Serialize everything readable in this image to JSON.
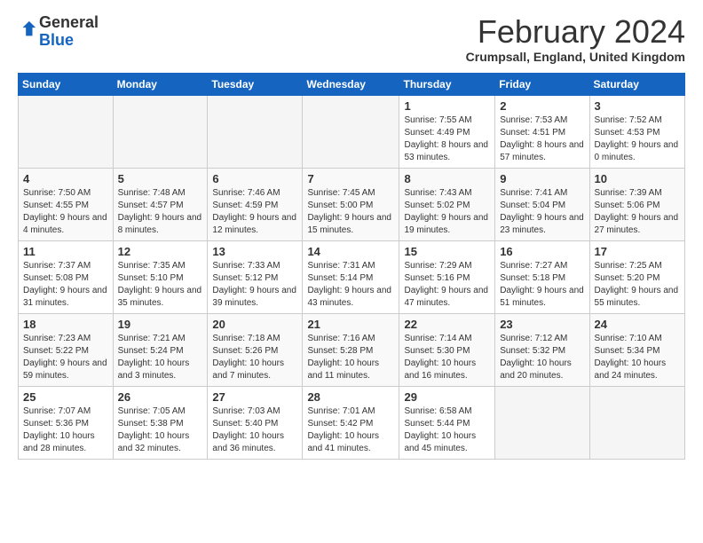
{
  "header": {
    "logo_general": "General",
    "logo_blue": "Blue",
    "month_title": "February 2024",
    "location": "Crumpsall, England, United Kingdom"
  },
  "weekdays": [
    "Sunday",
    "Monday",
    "Tuesday",
    "Wednesday",
    "Thursday",
    "Friday",
    "Saturday"
  ],
  "weeks": [
    [
      {
        "day": "",
        "empty": true
      },
      {
        "day": "",
        "empty": true
      },
      {
        "day": "",
        "empty": true
      },
      {
        "day": "",
        "empty": true
      },
      {
        "day": "1",
        "sunrise": "Sunrise: 7:55 AM",
        "sunset": "Sunset: 4:49 PM",
        "daylight": "Daylight: 8 hours and 53 minutes."
      },
      {
        "day": "2",
        "sunrise": "Sunrise: 7:53 AM",
        "sunset": "Sunset: 4:51 PM",
        "daylight": "Daylight: 8 hours and 57 minutes."
      },
      {
        "day": "3",
        "sunrise": "Sunrise: 7:52 AM",
        "sunset": "Sunset: 4:53 PM",
        "daylight": "Daylight: 9 hours and 0 minutes."
      }
    ],
    [
      {
        "day": "4",
        "sunrise": "Sunrise: 7:50 AM",
        "sunset": "Sunset: 4:55 PM",
        "daylight": "Daylight: 9 hours and 4 minutes."
      },
      {
        "day": "5",
        "sunrise": "Sunrise: 7:48 AM",
        "sunset": "Sunset: 4:57 PM",
        "daylight": "Daylight: 9 hours and 8 minutes."
      },
      {
        "day": "6",
        "sunrise": "Sunrise: 7:46 AM",
        "sunset": "Sunset: 4:59 PM",
        "daylight": "Daylight: 9 hours and 12 minutes."
      },
      {
        "day": "7",
        "sunrise": "Sunrise: 7:45 AM",
        "sunset": "Sunset: 5:00 PM",
        "daylight": "Daylight: 9 hours and 15 minutes."
      },
      {
        "day": "8",
        "sunrise": "Sunrise: 7:43 AM",
        "sunset": "Sunset: 5:02 PM",
        "daylight": "Daylight: 9 hours and 19 minutes."
      },
      {
        "day": "9",
        "sunrise": "Sunrise: 7:41 AM",
        "sunset": "Sunset: 5:04 PM",
        "daylight": "Daylight: 9 hours and 23 minutes."
      },
      {
        "day": "10",
        "sunrise": "Sunrise: 7:39 AM",
        "sunset": "Sunset: 5:06 PM",
        "daylight": "Daylight: 9 hours and 27 minutes."
      }
    ],
    [
      {
        "day": "11",
        "sunrise": "Sunrise: 7:37 AM",
        "sunset": "Sunset: 5:08 PM",
        "daylight": "Daylight: 9 hours and 31 minutes."
      },
      {
        "day": "12",
        "sunrise": "Sunrise: 7:35 AM",
        "sunset": "Sunset: 5:10 PM",
        "daylight": "Daylight: 9 hours and 35 minutes."
      },
      {
        "day": "13",
        "sunrise": "Sunrise: 7:33 AM",
        "sunset": "Sunset: 5:12 PM",
        "daylight": "Daylight: 9 hours and 39 minutes."
      },
      {
        "day": "14",
        "sunrise": "Sunrise: 7:31 AM",
        "sunset": "Sunset: 5:14 PM",
        "daylight": "Daylight: 9 hours and 43 minutes."
      },
      {
        "day": "15",
        "sunrise": "Sunrise: 7:29 AM",
        "sunset": "Sunset: 5:16 PM",
        "daylight": "Daylight: 9 hours and 47 minutes."
      },
      {
        "day": "16",
        "sunrise": "Sunrise: 7:27 AM",
        "sunset": "Sunset: 5:18 PM",
        "daylight": "Daylight: 9 hours and 51 minutes."
      },
      {
        "day": "17",
        "sunrise": "Sunrise: 7:25 AM",
        "sunset": "Sunset: 5:20 PM",
        "daylight": "Daylight: 9 hours and 55 minutes."
      }
    ],
    [
      {
        "day": "18",
        "sunrise": "Sunrise: 7:23 AM",
        "sunset": "Sunset: 5:22 PM",
        "daylight": "Daylight: 9 hours and 59 minutes."
      },
      {
        "day": "19",
        "sunrise": "Sunrise: 7:21 AM",
        "sunset": "Sunset: 5:24 PM",
        "daylight": "Daylight: 10 hours and 3 minutes."
      },
      {
        "day": "20",
        "sunrise": "Sunrise: 7:18 AM",
        "sunset": "Sunset: 5:26 PM",
        "daylight": "Daylight: 10 hours and 7 minutes."
      },
      {
        "day": "21",
        "sunrise": "Sunrise: 7:16 AM",
        "sunset": "Sunset: 5:28 PM",
        "daylight": "Daylight: 10 hours and 11 minutes."
      },
      {
        "day": "22",
        "sunrise": "Sunrise: 7:14 AM",
        "sunset": "Sunset: 5:30 PM",
        "daylight": "Daylight: 10 hours and 16 minutes."
      },
      {
        "day": "23",
        "sunrise": "Sunrise: 7:12 AM",
        "sunset": "Sunset: 5:32 PM",
        "daylight": "Daylight: 10 hours and 20 minutes."
      },
      {
        "day": "24",
        "sunrise": "Sunrise: 7:10 AM",
        "sunset": "Sunset: 5:34 PM",
        "daylight": "Daylight: 10 hours and 24 minutes."
      }
    ],
    [
      {
        "day": "25",
        "sunrise": "Sunrise: 7:07 AM",
        "sunset": "Sunset: 5:36 PM",
        "daylight": "Daylight: 10 hours and 28 minutes."
      },
      {
        "day": "26",
        "sunrise": "Sunrise: 7:05 AM",
        "sunset": "Sunset: 5:38 PM",
        "daylight": "Daylight: 10 hours and 32 minutes."
      },
      {
        "day": "27",
        "sunrise": "Sunrise: 7:03 AM",
        "sunset": "Sunset: 5:40 PM",
        "daylight": "Daylight: 10 hours and 36 minutes."
      },
      {
        "day": "28",
        "sunrise": "Sunrise: 7:01 AM",
        "sunset": "Sunset: 5:42 PM",
        "daylight": "Daylight: 10 hours and 41 minutes."
      },
      {
        "day": "29",
        "sunrise": "Sunrise: 6:58 AM",
        "sunset": "Sunset: 5:44 PM",
        "daylight": "Daylight: 10 hours and 45 minutes."
      },
      {
        "day": "",
        "empty": true
      },
      {
        "day": "",
        "empty": true
      }
    ]
  ]
}
